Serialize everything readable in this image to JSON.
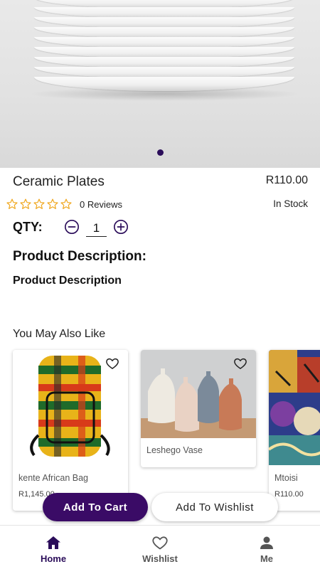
{
  "product": {
    "name": "Ceramic Plates",
    "price": "R110.00",
    "rating": 0,
    "reviews": "0 Reviews",
    "stock": "In Stock",
    "image_slide_index": 1,
    "image_slide_count": 1
  },
  "quantity": {
    "label": "QTY:",
    "value": "1"
  },
  "description": {
    "heading": "Product Description:",
    "text": "Product Description"
  },
  "related": {
    "heading": "You May Also Like",
    "items": [
      {
        "name": "kente African Bag",
        "price": "R1,145.00"
      },
      {
        "name": "Leshego Vase",
        "price": ""
      },
      {
        "name": "Mtoisi",
        "price": "R110.00"
      }
    ]
  },
  "actions": {
    "add_to_cart": "Add To Cart",
    "add_to_wishlist": "Add To Wishlist"
  },
  "nav": {
    "items": [
      {
        "label": "Home",
        "icon": "home-icon",
        "active": true
      },
      {
        "label": "Wishlist",
        "icon": "heart-icon",
        "active": false
      },
      {
        "label": "Me",
        "icon": "person-icon",
        "active": false
      }
    ]
  },
  "colors": {
    "accent": "#3a0b66",
    "star": "#f0a820",
    "nav_active": "#2b0d5a"
  }
}
